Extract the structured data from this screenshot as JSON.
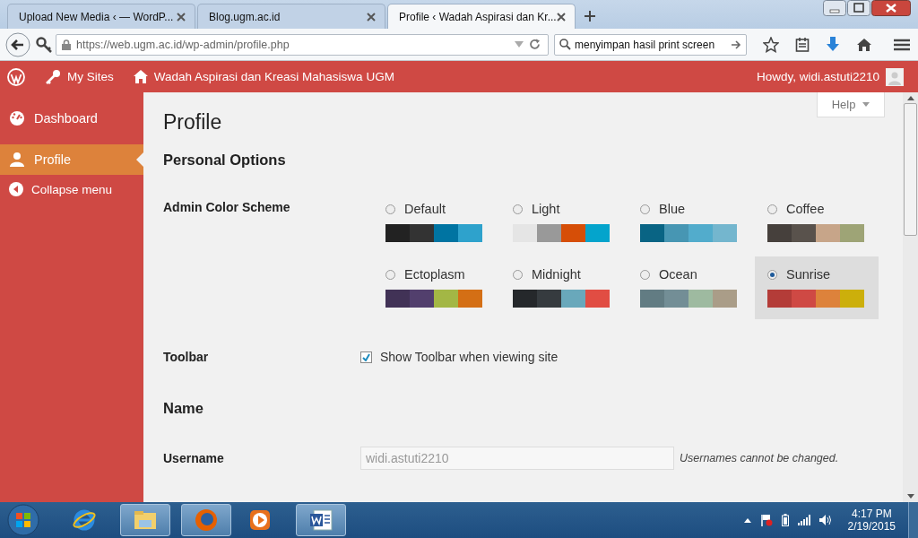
{
  "browser": {
    "tabs": [
      {
        "label": "Upload New Media ‹ — WordP...",
        "selected": false
      },
      {
        "label": "Blog.ugm.ac.id",
        "selected": false
      },
      {
        "label": "Profile ‹ Wadah Aspirasi dan Kr...",
        "selected": true
      }
    ],
    "address": "https://web.ugm.ac.id/wp-admin/profile.php",
    "search": {
      "value": "menyimpan hasil print screen"
    }
  },
  "admin_bar": {
    "my_sites": "My Sites",
    "site_name": "Wadah Aspirasi dan Kreasi Mahasiswa UGM",
    "howdy": "Howdy, widi.astuti2210"
  },
  "sidebar": {
    "items": [
      {
        "label": "Dashboard",
        "kind": "dashboard",
        "selected": false
      },
      {
        "label": "Profile",
        "kind": "profile",
        "selected": true
      }
    ],
    "collapse": "Collapse menu"
  },
  "page": {
    "title": "Profile",
    "help": "Help",
    "section_personal": "Personal Options",
    "color_scheme_label": "Admin Color Scheme",
    "schemes": [
      {
        "name": "Default",
        "selected": false,
        "swatches": [
          {
            "color": "#222222"
          },
          {
            "color": "#333333"
          },
          {
            "color": "#0074a2"
          },
          {
            "color": "#2ea2cc"
          }
        ]
      },
      {
        "name": "Light",
        "selected": false,
        "swatches": [
          {
            "color": "#e5e5e5"
          },
          {
            "color": "#999999"
          },
          {
            "color": "#d64e07"
          },
          {
            "color": "#04a4cc"
          }
        ]
      },
      {
        "name": "Blue",
        "selected": false,
        "swatches": [
          {
            "color": "#096484"
          },
          {
            "color": "#4796b3"
          },
          {
            "color": "#52accc"
          },
          {
            "color": "#74b6ce"
          }
        ]
      },
      {
        "name": "Coffee",
        "selected": false,
        "swatches": [
          {
            "color": "#46403c"
          },
          {
            "color": "#59524c"
          },
          {
            "color": "#c7a589"
          },
          {
            "color": "#9ea476"
          }
        ]
      },
      {
        "name": "Ectoplasm",
        "selected": false,
        "swatches": [
          {
            "color": "#413256"
          },
          {
            "color": "#523f6d"
          },
          {
            "color": "#a3b745"
          },
          {
            "color": "#d46f15"
          }
        ]
      },
      {
        "name": "Midnight",
        "selected": false,
        "swatches": [
          {
            "color": "#25282b"
          },
          {
            "color": "#363b3f"
          },
          {
            "color": "#69a8bb"
          },
          {
            "color": "#e14d43"
          }
        ]
      },
      {
        "name": "Ocean",
        "selected": false,
        "swatches": [
          {
            "color": "#627c83"
          },
          {
            "color": "#738e96"
          },
          {
            "color": "#9ebaa0"
          },
          {
            "color": "#aa9d88"
          }
        ]
      },
      {
        "name": "Sunrise",
        "selected": true,
        "swatches": [
          {
            "color": "#b43c38"
          },
          {
            "color": "#cf4944"
          },
          {
            "color": "#dd823b"
          },
          {
            "color": "#ccaf0b"
          }
        ]
      }
    ],
    "toolbar_label": "Toolbar",
    "toolbar_checkbox": {
      "label": "Show Toolbar when viewing site",
      "checked": true
    },
    "section_name": "Name",
    "username_label": "Username",
    "username_value": "widi.astuti2210",
    "username_note": "Usernames cannot be changed."
  },
  "taskbar": {
    "time": "4:17 PM",
    "date": "2/19/2015"
  }
}
